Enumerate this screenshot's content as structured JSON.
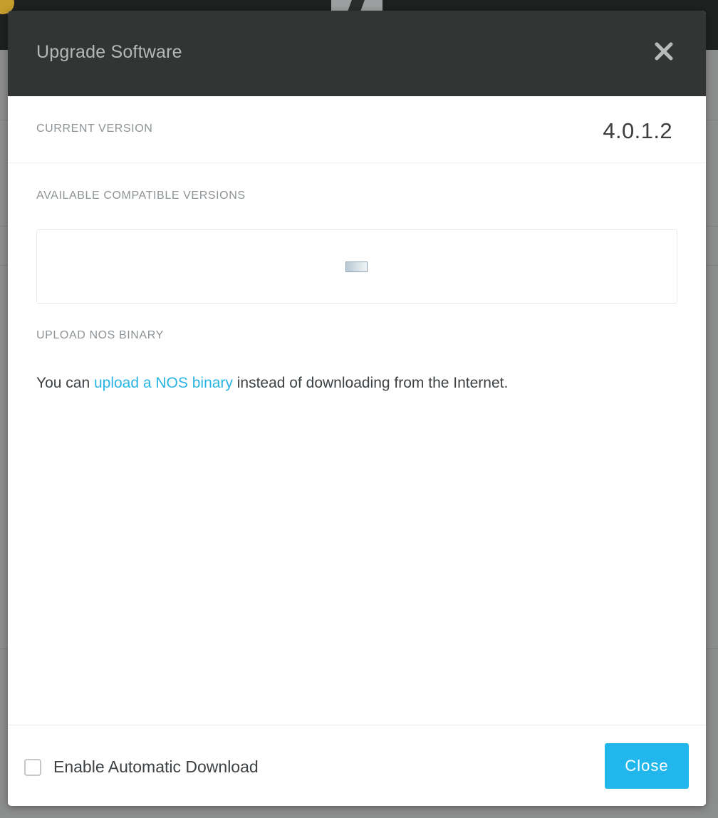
{
  "modal": {
    "title": "Upgrade Software",
    "close_icon": "close-icon"
  },
  "current_version": {
    "label": "CURRENT VERSION",
    "value": "4.0.1.2"
  },
  "available_versions": {
    "label": "AVAILABLE COMPATIBLE VERSIONS",
    "state_icon": "loading-icon"
  },
  "upload": {
    "label": "UPLOAD NOS BINARY",
    "sentence_prefix": "You can ",
    "link_text": "upload a NOS binary",
    "sentence_suffix": " instead of downloading from the Internet."
  },
  "footer": {
    "checkbox_label": "Enable Automatic Download",
    "checkbox_checked": false,
    "close_button": "Close"
  },
  "colors": {
    "header_bg": "#333535",
    "accent": "#21b6ec",
    "link": "#29b4e3"
  }
}
